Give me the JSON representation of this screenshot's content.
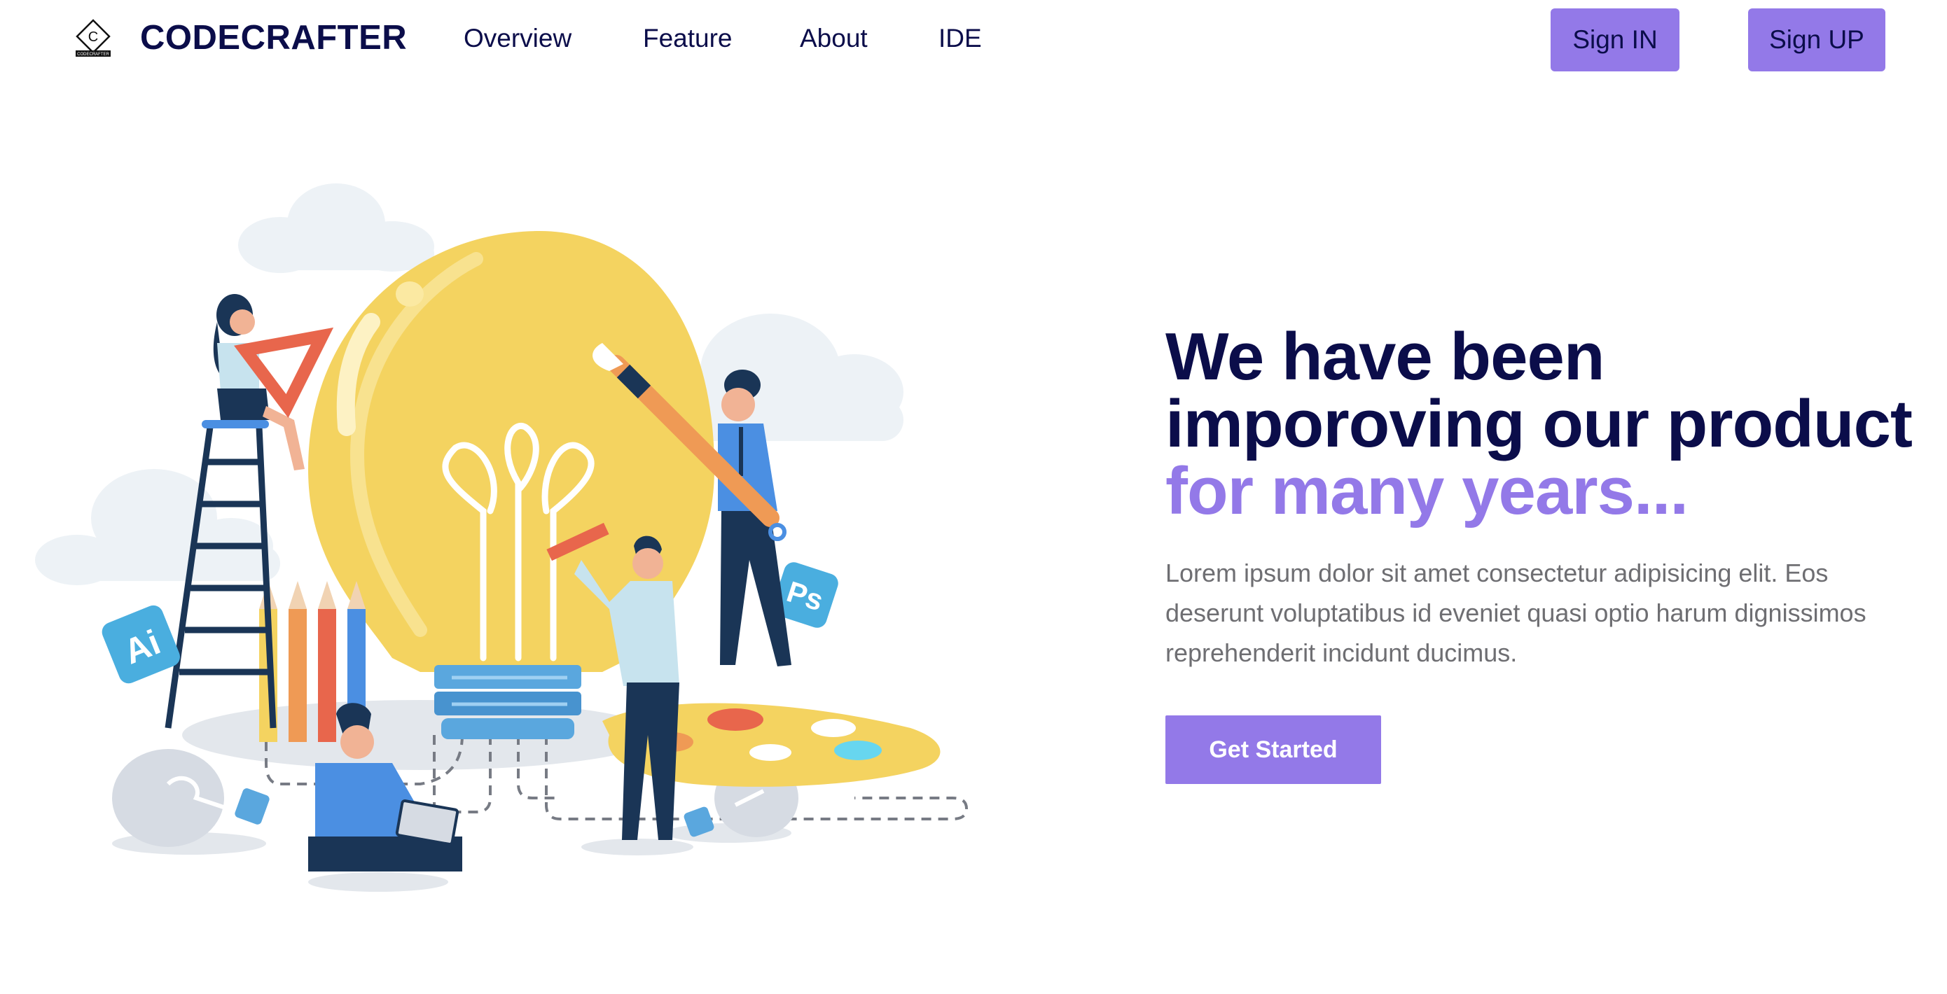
{
  "header": {
    "logo_icon": "codecrafter-diamond-logo-icon",
    "logo_letter": "C",
    "logo_caption": "CODECRAFTER",
    "brand": "CODECRAFTER",
    "nav": {
      "overview": "Overview",
      "feature": "Feature",
      "about": "About",
      "ide": "IDE"
    },
    "sign_in": "Sign IN",
    "sign_up": "Sign UP"
  },
  "hero": {
    "headline_line1": "We have been",
    "headline_line2": "imporoving our product",
    "headline_line3": "for many years...",
    "description": "Lorem ipsum dolor sit amet consectetur adipisicing elit. Eos deserunt voluptatibus id eveniet quasi optio harum dignissimos reprehenderit incidunt ducimus.",
    "cta": "Get Started",
    "illustration_icon": "creative-team-lightbulb-illustration",
    "illustration_badges": {
      "illustrator": "Ai",
      "photoshop": "Ps"
    }
  },
  "colors": {
    "brand_dark": "#0b0d4a",
    "accent": "#9379e8",
    "body_text": "#6e6e72",
    "bulb_yellow": "#f4d360"
  }
}
